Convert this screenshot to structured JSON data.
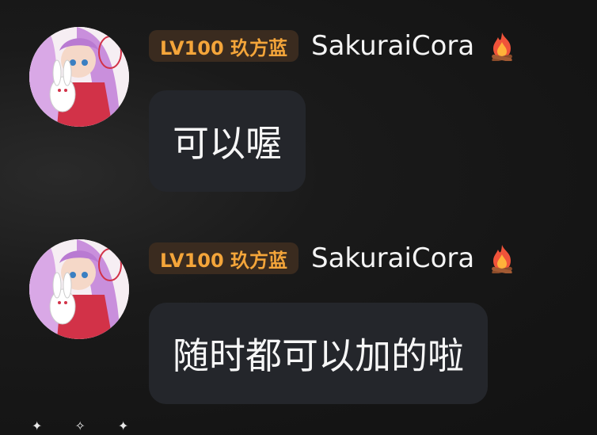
{
  "messages": [
    {
      "level_badge": "LV100 玖方蓝",
      "username": "SakuraiCora",
      "status_icon": "fire-icon",
      "text": "可以喔"
    },
    {
      "level_badge": "LV100 玖方蓝",
      "username": "SakuraiCora",
      "status_icon": "fire-icon",
      "text": "随时都可以加的啦"
    }
  ],
  "colors": {
    "background": "#161616",
    "bubble": "#24262b",
    "badge_bg": "#3a2b1f",
    "badge_text": "#f4a53a",
    "username": "#f4f4f4",
    "message_text": "#f6f6f6"
  }
}
